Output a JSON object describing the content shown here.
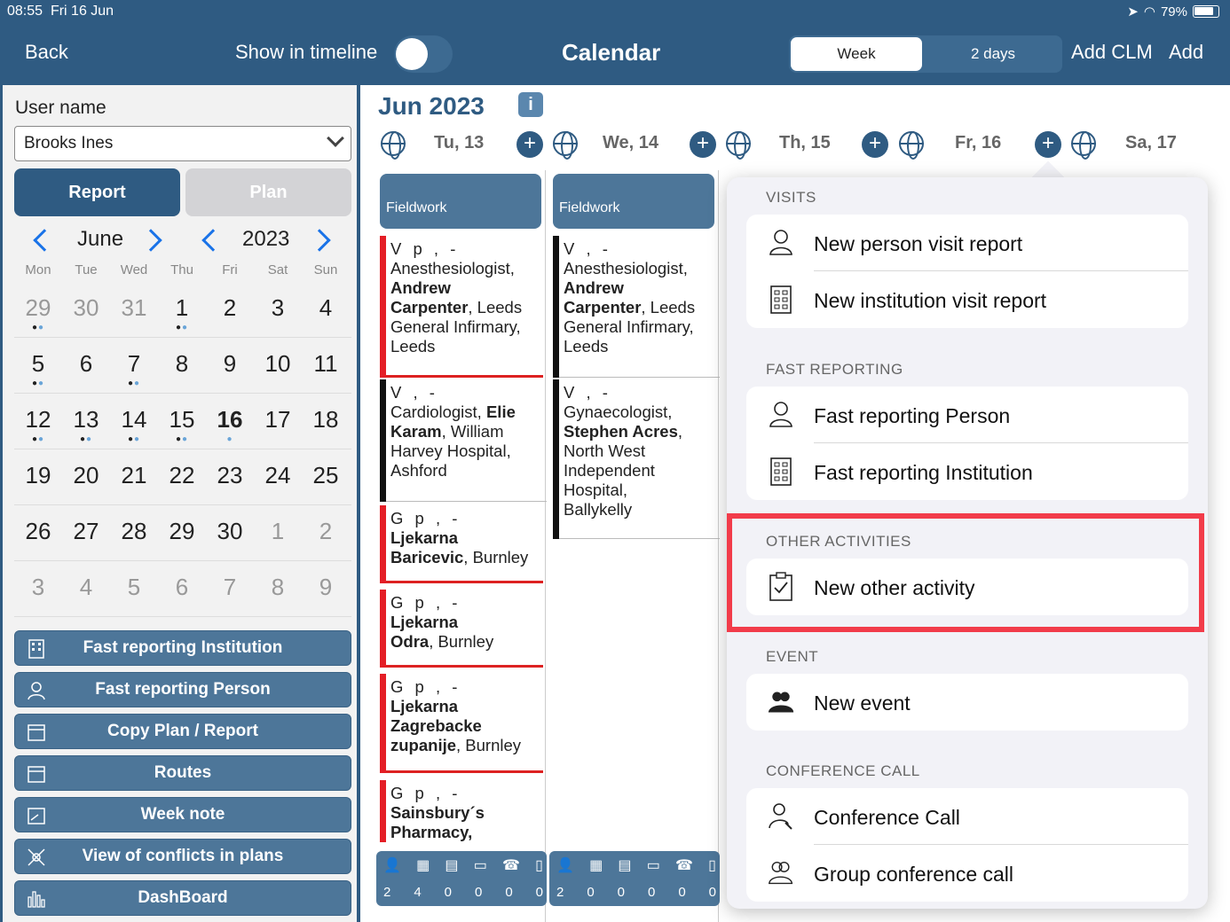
{
  "status": {
    "time": "08:55",
    "date": "Fri 16 Jun",
    "battery": "79%"
  },
  "header": {
    "back": "Back",
    "show_timeline": "Show in timeline",
    "title": "Calendar",
    "seg_week": "Week",
    "seg_2days": "2 days",
    "add_clm": "Add CLM",
    "add": "Add"
  },
  "left": {
    "user_label": "User name",
    "user_value": "Brooks Ines",
    "report": "Report",
    "plan": "Plan",
    "month": "June",
    "year": "2023",
    "dow": [
      "Mon",
      "Tue",
      "Wed",
      "Thu",
      "Fri",
      "Sat",
      "Sun"
    ],
    "weeks": [
      [
        "29",
        "30",
        "31",
        "1",
        "2",
        "3",
        "4"
      ],
      [
        "5",
        "6",
        "7",
        "8",
        "9",
        "10",
        "11"
      ],
      [
        "12",
        "13",
        "14",
        "15",
        "16",
        "17",
        "18"
      ],
      [
        "19",
        "20",
        "21",
        "22",
        "23",
        "24",
        "25"
      ],
      [
        "26",
        "27",
        "28",
        "29",
        "30",
        "1",
        "2"
      ],
      [
        "3",
        "4",
        "5",
        "6",
        "7",
        "8",
        "9"
      ]
    ],
    "buttons": [
      "Fast reporting  Institution",
      "Fast reporting  Person",
      "Copy Plan / Report",
      "Routes",
      "Week note",
      "View of conflicts in plans",
      "DashBoard"
    ]
  },
  "main": {
    "month_label": "Jun 2023",
    "info": "i",
    "days": [
      "Tu, 13",
      "We, 14",
      "Th, 15",
      "Fr, 16",
      "Sa, 17"
    ],
    "fieldwork": "Fieldwork",
    "col_tue": {
      "cards": [
        {
          "head": "V p ,  -",
          "l1": "Anesthesiologist,",
          "l2b": "Andrew",
          "l3b": "Carpenter",
          "l3": ", Leeds",
          "l4": "General Infirmary,",
          "l5": "Leeds"
        },
        {
          "head": "V ,  -",
          "l1": "Cardiologist, ",
          "l1b": "Elie",
          "l2b": "Karam",
          "l2": ", William",
          "l3": "Harvey Hospital,",
          "l4": "Ashford"
        },
        {
          "head": "G p ,  -",
          "l1b": "Ljekarna",
          "l2b": "Baricevic",
          "l2": ", Burnley"
        },
        {
          "head": "G p ,  -",
          "l1b": "Ljekarna",
          "l2b": "Odra",
          "l2": ", Burnley"
        },
        {
          "head": "G p ,  -",
          "l1b": "Ljekarna",
          "l2b": "Zagrebacke",
          "l3b": "zupanije",
          "l3": ", Burnley"
        },
        {
          "head": "G p ,  -",
          "l1b": "Sainsbury´s",
          "l2b": "Pharmacy,"
        }
      ],
      "counts": [
        "2",
        "4",
        "0",
        "0",
        "0",
        "0"
      ]
    },
    "col_wed": {
      "cards": [
        {
          "head": "V ,  -",
          "l1": "Anesthesiologist,",
          "l2b": "Andrew",
          "l3b": "Carpenter",
          "l3": ", Leeds",
          "l4": "General Infirmary,",
          "l5": "Leeds"
        },
        {
          "head": "V ,  -",
          "l1": "Gynaecologist,",
          "l2b": "Stephen Acres",
          "l2": ",",
          "l3": "North West",
          "l4": "Independent",
          "l5": "Hospital,",
          "l6": "Ballykelly"
        }
      ],
      "counts": [
        "2",
        "0",
        "0",
        "0",
        "0",
        "0"
      ]
    }
  },
  "popover": {
    "visits": "VISITS",
    "new_person_visit": "New person visit report",
    "new_institution_visit": "New institution visit report",
    "fast_reporting": "FAST REPORTING",
    "fast_person": "Fast reporting  Person",
    "fast_institution": "Fast reporting  Institution",
    "other_activities": "OTHER ACTIVITIES",
    "new_other_activity": "New other activity",
    "event": "EVENT",
    "new_event": "New event",
    "conference_call_header": "CONFERENCE CALL",
    "conference_call": "Conference Call",
    "group_conference_call": "Group conference call"
  },
  "colors": {
    "primary": "#2f5b82",
    "button": "#4d7699",
    "accent_red": "#e41e26",
    "highlight": "#f23c4a",
    "link_blue": "#1a73e8"
  }
}
